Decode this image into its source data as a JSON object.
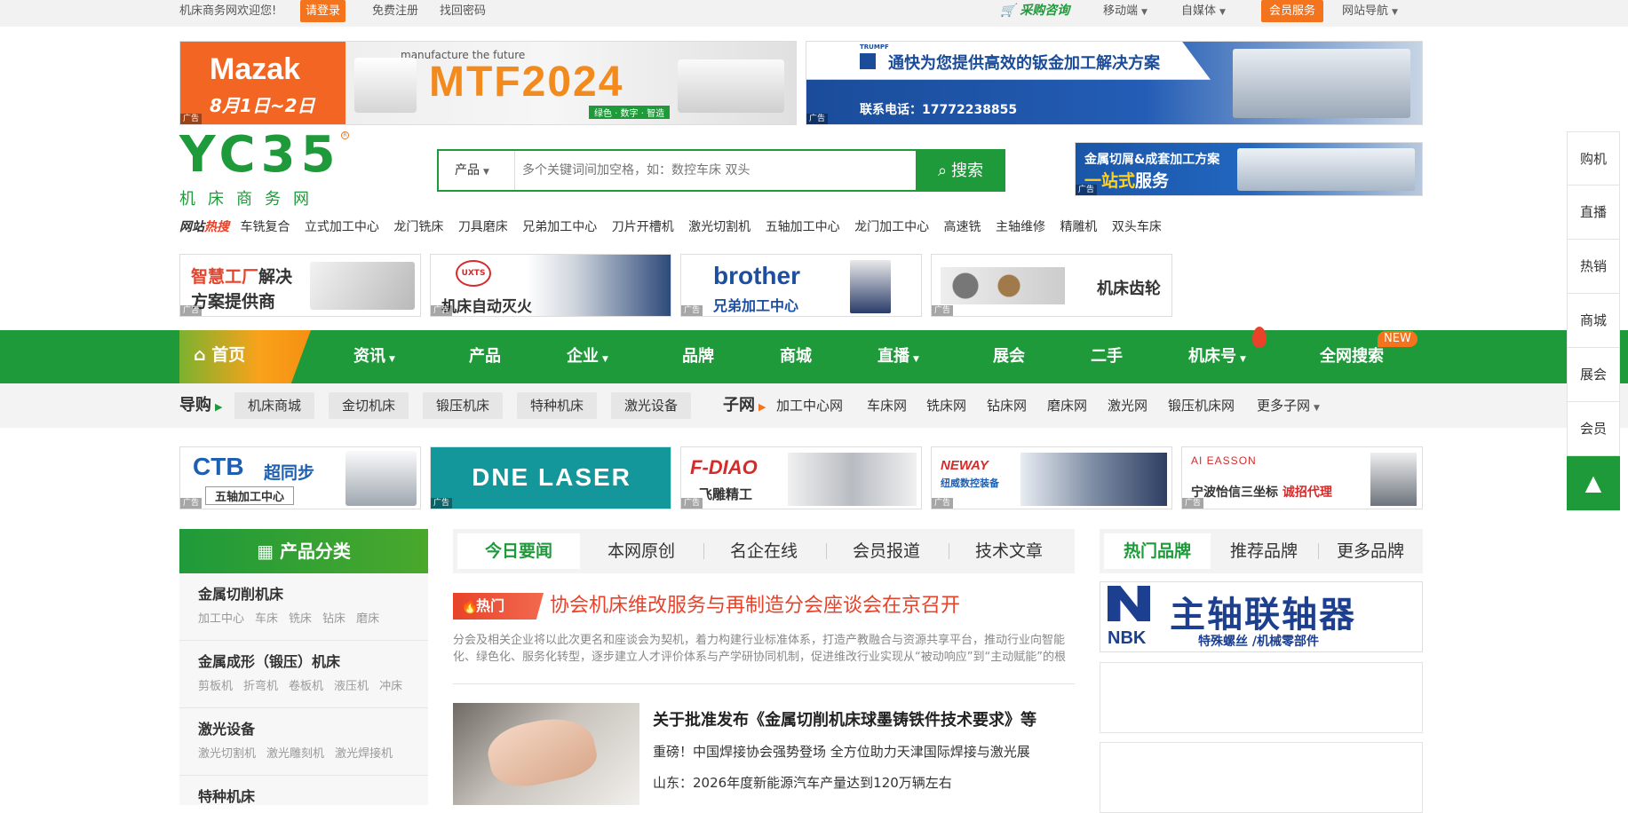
{
  "topbar": {
    "welcome": "机床商务网欢迎您!",
    "login": "请登录",
    "register": "免费注册",
    "recover": "找回密码",
    "purchase": "采购咨询",
    "mobile": "移动端",
    "media": "自媒体",
    "member": "会员服务",
    "sitenav": "网站导航"
  },
  "ads_top": {
    "left_brand": "Mazak",
    "left_date": "8月1日~2日",
    "left_tagline": "manufacture the future",
    "left_title": "MTF2024",
    "left_sub": "绿色 · 数字 · 智造",
    "right_brand": "TRUMPF",
    "right_title": "通快为您提供高效的钣金加工解决方案",
    "right_phone": "联系电话：17772238855",
    "ad_label": "广告"
  },
  "logo": {
    "mark": "YC35",
    "name": "机床商务网"
  },
  "search": {
    "category": "产品",
    "placeholder": "多个关键词间加空格，如：数控车床 双头",
    "button": "搜索"
  },
  "banner_right": {
    "line1": "金属切屑&成套加工方案",
    "line2_hl": "一站式",
    "line2": "服务"
  },
  "hot": {
    "label_a": "网站",
    "label_b": "热搜",
    "keywords": [
      "车铣复合",
      "立式加工中心",
      "龙门铣床",
      "刀具磨床",
      "兄弟加工中心",
      "刀片开槽机",
      "激光切割机",
      "五轴加工中心",
      "龙门加工中心",
      "高速铣",
      "主轴维修",
      "精雕机",
      "双头车床"
    ]
  },
  "ads_row1": [
    {
      "a": "智慧工厂",
      "b": "解决",
      "c": "方案提供商"
    },
    {
      "logo": "UXTS",
      "text": "机床自动灭火"
    },
    {
      "logo": "brother",
      "text": "兄弟加工中心"
    },
    {
      "text": "机床齿轮"
    }
  ],
  "nav": {
    "home": "首页",
    "items": [
      "资讯",
      "产品",
      "企业",
      "品牌",
      "商城",
      "直播",
      "展会",
      "二手",
      "机床号",
      "全网搜索"
    ],
    "new_badge": "NEW"
  },
  "subnav": {
    "guide": "导购",
    "guide_items": [
      "机床商城",
      "金切机床",
      "锻压机床",
      "特种机床",
      "激光设备"
    ],
    "subnet": "子网",
    "subnet_items": [
      "加工中心网",
      "车床网",
      "铣床网",
      "钻床网",
      "磨床网",
      "激光网",
      "锻压机床网"
    ],
    "more": "更多子网"
  },
  "ads_row2": [
    {
      "logo": "CTB",
      "title": "超同步",
      "sub": "五轴加工中心"
    },
    {
      "logo": "DNE LASER"
    },
    {
      "logo": "F-DIAO",
      "sub": "飞雕精工"
    },
    {
      "logo": "NEWAY",
      "sub": "纽威数控装备"
    },
    {
      "logo": "AI EASSON",
      "text": "宁波怡信三坐标",
      "hl": "诚招代理"
    }
  ],
  "right_sidebar": {
    "items": [
      "购机",
      "直播",
      "热销",
      "商城",
      "展会",
      "会员"
    ],
    "top": "▲"
  },
  "categories": {
    "title": "产品分类",
    "items": [
      {
        "name": "金属切削机床",
        "subs": [
          "加工中心",
          "车床",
          "铣床",
          "钻床",
          "磨床"
        ]
      },
      {
        "name": "金属成形（锻压）机床",
        "subs": [
          "剪板机",
          "折弯机",
          "卷板机",
          "液压机",
          "冲床"
        ]
      },
      {
        "name": "激光设备",
        "subs": [
          "激光切割机",
          "激光雕刻机",
          "激光焊接机"
        ]
      },
      {
        "name": "特种机床",
        "subs": []
      }
    ]
  },
  "news": {
    "tabs": [
      "今日要闻",
      "本网原创",
      "名企在线",
      "会员报道",
      "技术文章"
    ],
    "hot_label": "热门",
    "headline": "协会机床维改服务与再制造分会座谈会在京召开",
    "summary": "分会及相关企业将以此次更名和座谈会为契机，着力构建行业标准体系，打造产教融合与资源共享平台，推动行业向智能化、绿色化、服务化转型，逐步建立人才评价体系与产学研协同机制，促进维改行业实现从“被动响应”到“主动赋能”的根本",
    "lines": [
      "关于批准发布《金属切削机床球墨铸铁件技术要求》等",
      "重磅！中国焊接协会强势登场 全方位助力天津国际焊接与激光展",
      "山东：2026年度新能源汽车产量达到120万辆左右"
    ]
  },
  "brands": {
    "tabs": [
      "热门品牌",
      "推荐品牌",
      "更多品牌"
    ],
    "ad_logo": "NBK",
    "ad_title": "主轴联轴器",
    "ad_sub": "特殊螺丝 /机械零部件"
  }
}
